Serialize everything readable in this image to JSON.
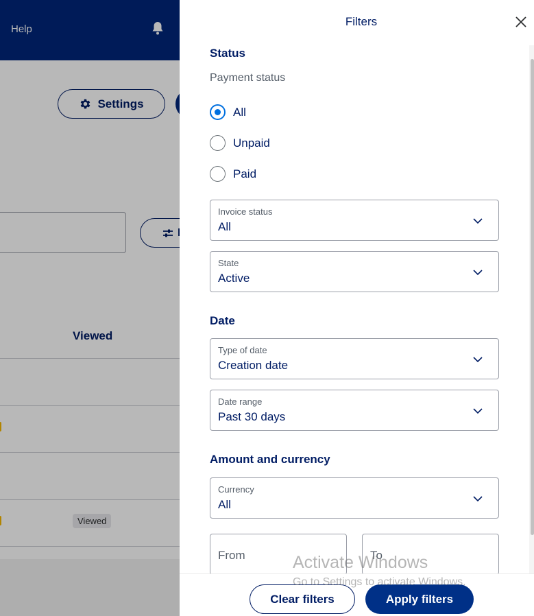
{
  "background": {
    "help_label": "Help",
    "settings_button": "Settings",
    "filter_button_partial": "F",
    "column_header": "Viewed",
    "row_badge": "Viewed",
    "header_color": "#00267a",
    "icons": [
      "bell-icon",
      "gear-icon",
      "sliders-icon"
    ]
  },
  "drawer": {
    "title": "Filters",
    "close_icon": "close-icon",
    "status": {
      "heading": "Status",
      "payment_status_label": "Payment status",
      "options": [
        {
          "label": "All",
          "checked": true
        },
        {
          "label": "Unpaid",
          "checked": false
        },
        {
          "label": "Paid",
          "checked": false
        }
      ],
      "invoice_status": {
        "label": "Invoice status",
        "value": "All"
      },
      "state": {
        "label": "State",
        "value": "Active"
      }
    },
    "date": {
      "heading": "Date",
      "type_of_date": {
        "label": "Type of date",
        "value": "Creation date"
      },
      "date_range": {
        "label": "Date range",
        "value": "Past 30 days"
      }
    },
    "amount": {
      "heading": "Amount and currency",
      "currency": {
        "label": "Currency",
        "value": "All"
      },
      "from_placeholder": "From",
      "to_placeholder": "To"
    },
    "footer": {
      "clear_label": "Clear filters",
      "apply_label": "Apply filters"
    },
    "accent_color": "#0070e0",
    "primary_color": "#003087"
  },
  "watermark": {
    "title": "Activate Windows",
    "subtitle": "Go to Settings to activate Windows."
  }
}
